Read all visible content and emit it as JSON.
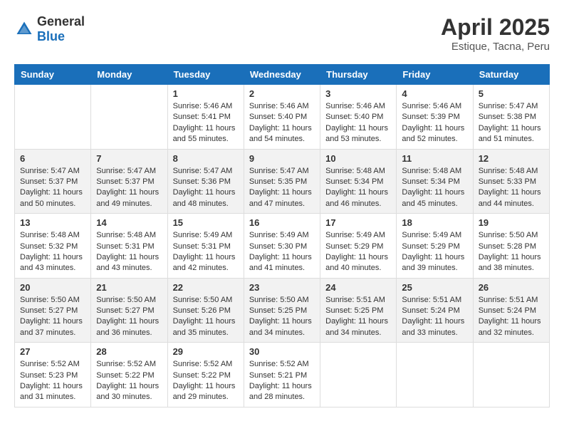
{
  "header": {
    "logo_general": "General",
    "logo_blue": "Blue",
    "title": "April 2025",
    "subtitle": "Estique, Tacna, Peru"
  },
  "weekdays": [
    "Sunday",
    "Monday",
    "Tuesday",
    "Wednesday",
    "Thursday",
    "Friday",
    "Saturday"
  ],
  "weeks": [
    [
      {
        "day": "",
        "info": ""
      },
      {
        "day": "",
        "info": ""
      },
      {
        "day": "1",
        "info": "Sunrise: 5:46 AM\nSunset: 5:41 PM\nDaylight: 11 hours and 55 minutes."
      },
      {
        "day": "2",
        "info": "Sunrise: 5:46 AM\nSunset: 5:40 PM\nDaylight: 11 hours and 54 minutes."
      },
      {
        "day": "3",
        "info": "Sunrise: 5:46 AM\nSunset: 5:40 PM\nDaylight: 11 hours and 53 minutes."
      },
      {
        "day": "4",
        "info": "Sunrise: 5:46 AM\nSunset: 5:39 PM\nDaylight: 11 hours and 52 minutes."
      },
      {
        "day": "5",
        "info": "Sunrise: 5:47 AM\nSunset: 5:38 PM\nDaylight: 11 hours and 51 minutes."
      }
    ],
    [
      {
        "day": "6",
        "info": "Sunrise: 5:47 AM\nSunset: 5:37 PM\nDaylight: 11 hours and 50 minutes."
      },
      {
        "day": "7",
        "info": "Sunrise: 5:47 AM\nSunset: 5:37 PM\nDaylight: 11 hours and 49 minutes."
      },
      {
        "day": "8",
        "info": "Sunrise: 5:47 AM\nSunset: 5:36 PM\nDaylight: 11 hours and 48 minutes."
      },
      {
        "day": "9",
        "info": "Sunrise: 5:47 AM\nSunset: 5:35 PM\nDaylight: 11 hours and 47 minutes."
      },
      {
        "day": "10",
        "info": "Sunrise: 5:48 AM\nSunset: 5:34 PM\nDaylight: 11 hours and 46 minutes."
      },
      {
        "day": "11",
        "info": "Sunrise: 5:48 AM\nSunset: 5:34 PM\nDaylight: 11 hours and 45 minutes."
      },
      {
        "day": "12",
        "info": "Sunrise: 5:48 AM\nSunset: 5:33 PM\nDaylight: 11 hours and 44 minutes."
      }
    ],
    [
      {
        "day": "13",
        "info": "Sunrise: 5:48 AM\nSunset: 5:32 PM\nDaylight: 11 hours and 43 minutes."
      },
      {
        "day": "14",
        "info": "Sunrise: 5:48 AM\nSunset: 5:31 PM\nDaylight: 11 hours and 43 minutes."
      },
      {
        "day": "15",
        "info": "Sunrise: 5:49 AM\nSunset: 5:31 PM\nDaylight: 11 hours and 42 minutes."
      },
      {
        "day": "16",
        "info": "Sunrise: 5:49 AM\nSunset: 5:30 PM\nDaylight: 11 hours and 41 minutes."
      },
      {
        "day": "17",
        "info": "Sunrise: 5:49 AM\nSunset: 5:29 PM\nDaylight: 11 hours and 40 minutes."
      },
      {
        "day": "18",
        "info": "Sunrise: 5:49 AM\nSunset: 5:29 PM\nDaylight: 11 hours and 39 minutes."
      },
      {
        "day": "19",
        "info": "Sunrise: 5:50 AM\nSunset: 5:28 PM\nDaylight: 11 hours and 38 minutes."
      }
    ],
    [
      {
        "day": "20",
        "info": "Sunrise: 5:50 AM\nSunset: 5:27 PM\nDaylight: 11 hours and 37 minutes."
      },
      {
        "day": "21",
        "info": "Sunrise: 5:50 AM\nSunset: 5:27 PM\nDaylight: 11 hours and 36 minutes."
      },
      {
        "day": "22",
        "info": "Sunrise: 5:50 AM\nSunset: 5:26 PM\nDaylight: 11 hours and 35 minutes."
      },
      {
        "day": "23",
        "info": "Sunrise: 5:50 AM\nSunset: 5:25 PM\nDaylight: 11 hours and 34 minutes."
      },
      {
        "day": "24",
        "info": "Sunrise: 5:51 AM\nSunset: 5:25 PM\nDaylight: 11 hours and 34 minutes."
      },
      {
        "day": "25",
        "info": "Sunrise: 5:51 AM\nSunset: 5:24 PM\nDaylight: 11 hours and 33 minutes."
      },
      {
        "day": "26",
        "info": "Sunrise: 5:51 AM\nSunset: 5:24 PM\nDaylight: 11 hours and 32 minutes."
      }
    ],
    [
      {
        "day": "27",
        "info": "Sunrise: 5:52 AM\nSunset: 5:23 PM\nDaylight: 11 hours and 31 minutes."
      },
      {
        "day": "28",
        "info": "Sunrise: 5:52 AM\nSunset: 5:22 PM\nDaylight: 11 hours and 30 minutes."
      },
      {
        "day": "29",
        "info": "Sunrise: 5:52 AM\nSunset: 5:22 PM\nDaylight: 11 hours and 29 minutes."
      },
      {
        "day": "30",
        "info": "Sunrise: 5:52 AM\nSunset: 5:21 PM\nDaylight: 11 hours and 28 minutes."
      },
      {
        "day": "",
        "info": ""
      },
      {
        "day": "",
        "info": ""
      },
      {
        "day": "",
        "info": ""
      }
    ]
  ]
}
